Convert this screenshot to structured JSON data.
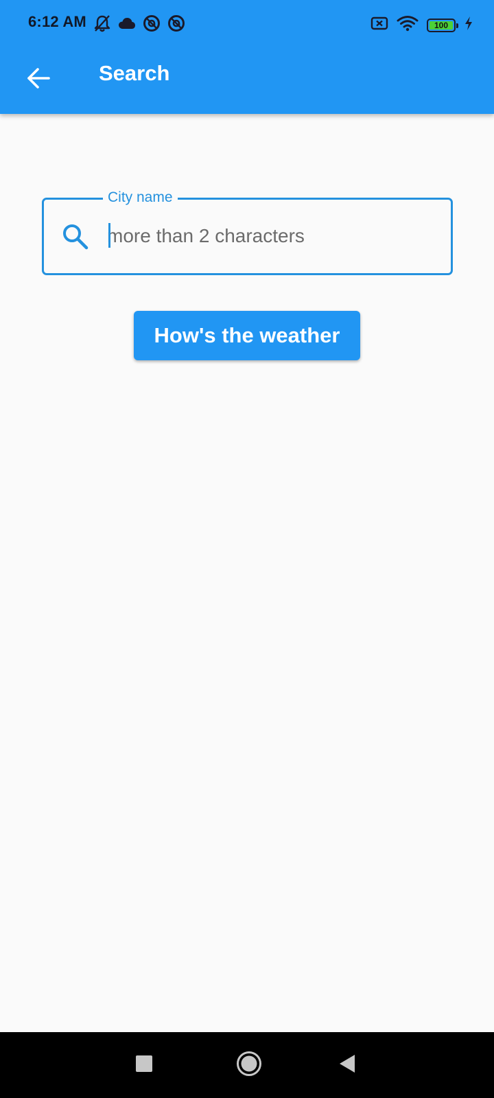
{
  "status_bar": {
    "time": "6:12 AM",
    "battery_level": "100",
    "icons_left": [
      "notifications-off-icon",
      "cloud-icon",
      "vpn-icon",
      "vpn-icon"
    ],
    "icons_right": [
      "no-sim-icon",
      "wifi-icon",
      "battery-icon",
      "charging-icon"
    ]
  },
  "app_bar": {
    "title": "Search",
    "back_icon": "arrow-back-icon",
    "color": "#2196f3"
  },
  "search_field": {
    "label": "City name",
    "placeholder": "more than 2 characters",
    "value": "",
    "icon": "search-icon",
    "accent_color": "#2491de"
  },
  "actions": {
    "submit_label": "How's the weather"
  },
  "nav_bar": {
    "buttons": [
      "recents-square-icon",
      "home-circle-icon",
      "back-triangle-icon"
    ]
  }
}
